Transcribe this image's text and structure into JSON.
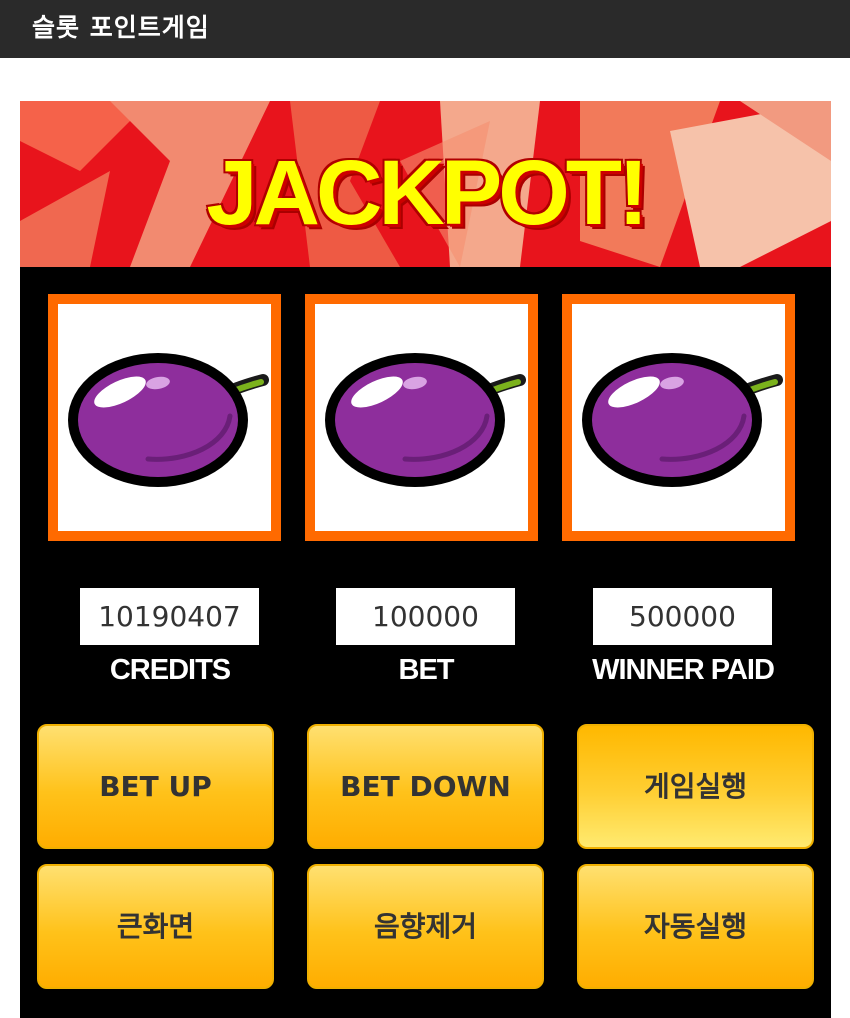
{
  "header": {
    "title": "슬롯 포인트게임"
  },
  "banner": {
    "text": "JACKPOT!"
  },
  "reels": [
    {
      "symbol": "plum-icon"
    },
    {
      "symbol": "plum-icon"
    },
    {
      "symbol": "plum-icon"
    }
  ],
  "stats": {
    "credits": {
      "value": "10190407",
      "label": "CREDITS"
    },
    "bet": {
      "value": "100000",
      "label": "BET"
    },
    "winner_paid": {
      "value": "500000",
      "label": "WINNER PAID"
    }
  },
  "buttons": {
    "bet_up": "BET UP",
    "bet_down": "BET DOWN",
    "run": "게임실행",
    "fullscreen": "큰화면",
    "mute": "음향제거",
    "auto": "자동실행"
  },
  "colors": {
    "frame": "#ff6a00",
    "button": "#ffc21a",
    "jackpot_text": "#ffff00",
    "banner_red": "#e8141c",
    "plum": "#8e2e9c"
  }
}
